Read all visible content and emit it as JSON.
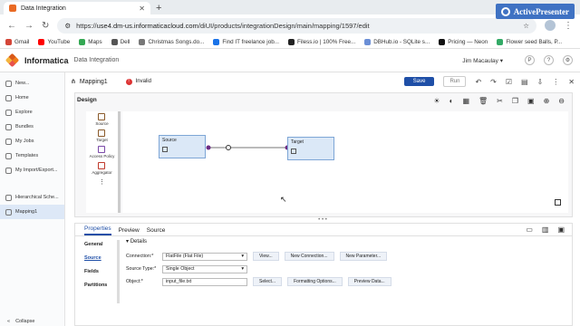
{
  "browser": {
    "tab_title": "Data Integration",
    "url_site": "use4.dm-us.informaticacloud.com",
    "url_path": "/diUI/products/integrationDesign/main/mapping/1597/edit",
    "url_scheme": "https://",
    "badge": "ActivePresenter",
    "bookmarks": [
      "Gmail",
      "YouTube",
      "Maps",
      "Dell",
      "Christmas Songs.do...",
      "Find IT freelance job...",
      "Filess.io | 100% Free...",
      "DBHub.io - SQLite s...",
      "Pricing — Neon",
      "Flower seed Balls, P..."
    ],
    "bookmark_colors": [
      "#d44638",
      "#ff0000",
      "#34a853",
      "#555",
      "#777",
      "#1a73e8",
      "#222",
      "#6b8fd6",
      "#111",
      "#3a6"
    ]
  },
  "app": {
    "brand": "Informatica",
    "product": "Data Integration",
    "user": "Jim Macaulay",
    "sidebar": [
      "New...",
      "Home",
      "Explore",
      "Bundles",
      "My Jobs",
      "Templates",
      "My Import/Export...",
      "Hierarchical Sche...",
      "Mapping1"
    ],
    "collapse": "Collapse"
  },
  "mapping": {
    "name": "Mapping1",
    "status": "Invalid",
    "save": "Save",
    "run": "Run"
  },
  "design": {
    "title": "Design",
    "palette": [
      "Source",
      "Target",
      "Access Policy",
      "Aggregator"
    ],
    "source_node": "Source",
    "target_node": "Target"
  },
  "properties": {
    "tabs": [
      "Properties",
      "Preview",
      "Source"
    ],
    "left": [
      "General",
      "Source",
      "Fields",
      "Partitions"
    ],
    "section": "Details",
    "fields": [
      {
        "label": "Connection:*",
        "value": "FlatFile (Flat File)",
        "buttons": [
          "View...",
          "New Connection...",
          "New Parameter..."
        ]
      },
      {
        "label": "Source Type:*",
        "value": "Single Object",
        "buttons": []
      },
      {
        "label": "Object:*",
        "value": "input_file.txt",
        "buttons": [
          "Select...",
          "Formatting Options...",
          "Preview Data..."
        ]
      }
    ]
  }
}
